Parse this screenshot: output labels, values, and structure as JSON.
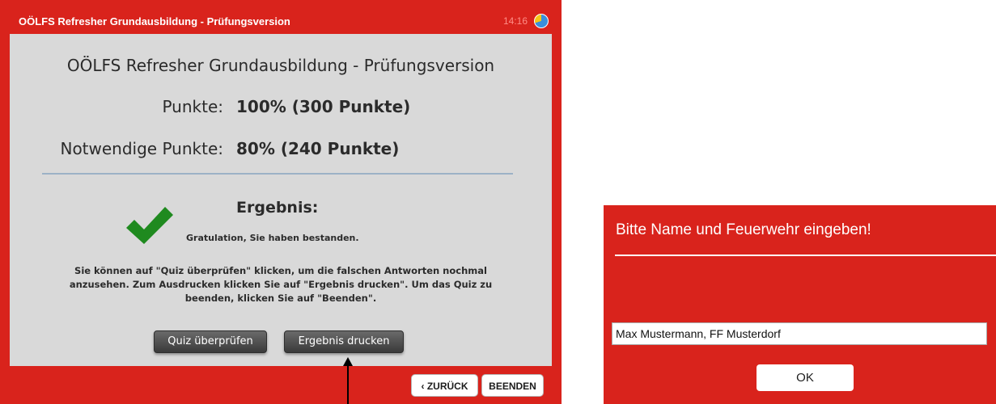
{
  "quiz_window": {
    "title": "OÖLFS Refresher Grundausbildung - Prüfungsversion",
    "time": "14:16",
    "panel_title": "OÖLFS Refresher Grundausbildung - Prüfungsversion",
    "points_label": "Punkte:",
    "points_value": "100% (300 Punkte)",
    "required_label": "Notwendige Punkte:",
    "required_value": "80% (240 Punkte)",
    "result_heading": "Ergebnis:",
    "congrats": "Gratulation, Sie haben bestanden.",
    "instructions": "Sie können auf \"Quiz überprüfen\" klicken, um die falschen Antworten nochmal anzusehen. Zum Ausdrucken klicken Sie auf \"Ergebnis drucken\". Um das Quiz zu beenden, klicken Sie auf \"Beenden\".",
    "review_button": "Quiz überprüfen",
    "print_button": "Ergebnis drucken",
    "back_button": "ZURÜCK",
    "finish_button": "BEENDEN"
  },
  "name_dialog": {
    "title": "Bitte Name und Feuerwehr eingeben!",
    "input_value": "Max Mustermann, FF Musterdorf",
    "ok_button": "OK"
  },
  "colors": {
    "accent_red": "#d9231c",
    "panel_grey": "#d9d9d9",
    "check_green": "#1f8a1f"
  },
  "icons": {
    "timer": "timer-icon",
    "check": "checkmark-icon",
    "back_chevron": "chevron-left-icon",
    "annotation": "arrow-up-icon"
  }
}
